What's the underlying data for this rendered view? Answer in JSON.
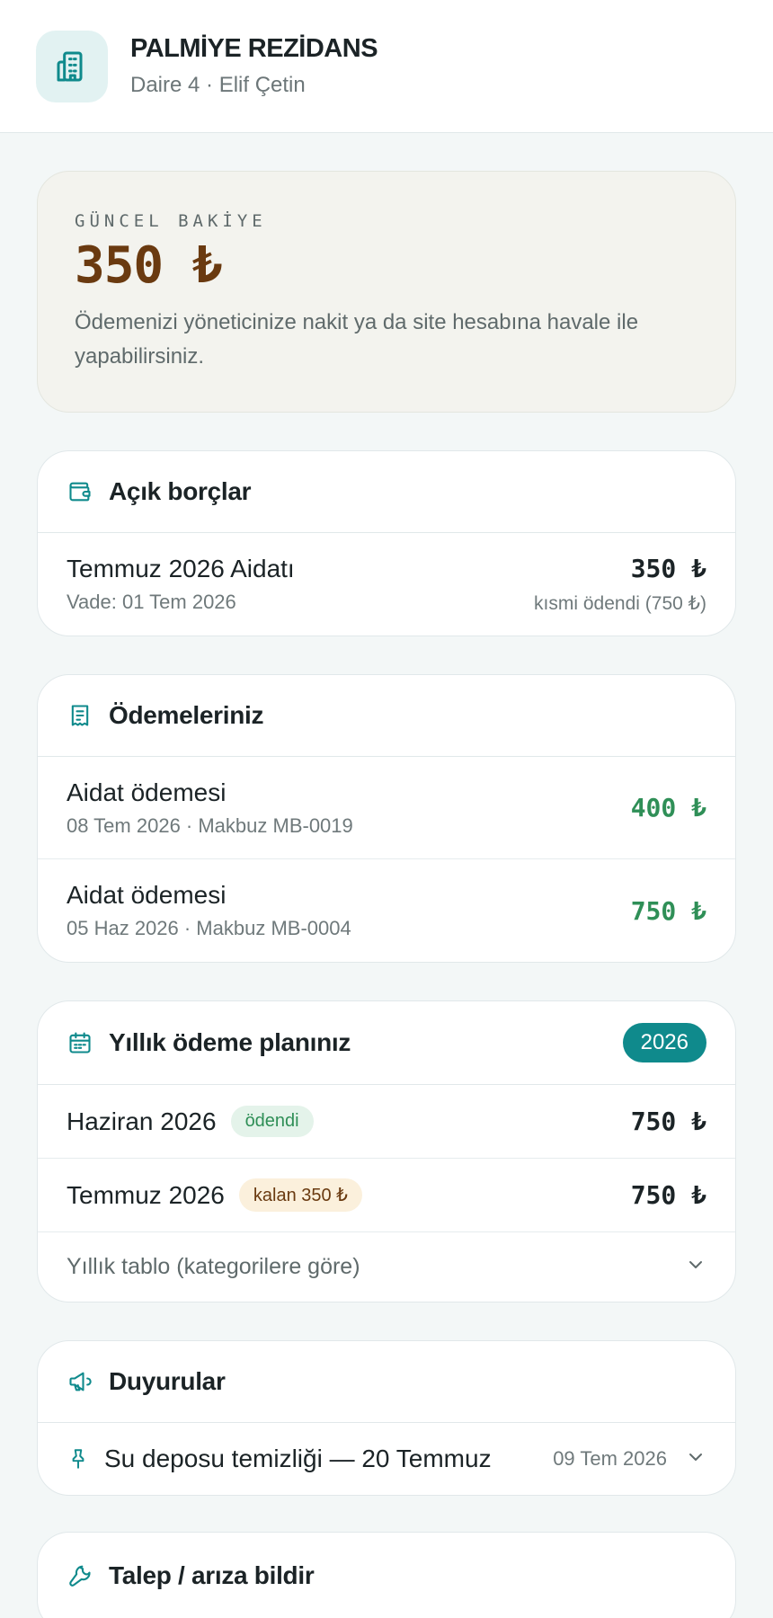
{
  "header": {
    "site_name": "PALMİYE REZİDANS",
    "subtitle": "Daire 4 · Elif Çetin",
    "logo_icon": "building-icon"
  },
  "balance": {
    "label": "GÜNCEL BAKİYE",
    "amount": "350 ₺",
    "note": "Ödemenizi yöneticinize nakit ya da site hesabına havale ile yapabilirsiniz."
  },
  "open_debts": {
    "title": "Açık borçlar",
    "icon": "wallet-icon",
    "items": [
      {
        "name": "Temmuz 2026 Aidatı",
        "due": "Vade: 01 Tem 2026",
        "amount": "350 ₺",
        "status": "kısmi ödendi (750 ₺)"
      }
    ]
  },
  "payments": {
    "title": "Ödemeleriniz",
    "icon": "receipt-icon",
    "items": [
      {
        "name": "Aidat ödemesi",
        "detail": "08 Tem 2026 · Makbuz MB-0019",
        "amount": "400 ₺"
      },
      {
        "name": "Aidat ödemesi",
        "detail": "05 Haz 2026 · Makbuz MB-0004",
        "amount": "750 ₺"
      }
    ]
  },
  "annual_plan": {
    "title": "Yıllık ödeme planınız",
    "icon": "calendar-icon",
    "year": "2026",
    "items": [
      {
        "month": "Haziran 2026",
        "badge": "ödendi",
        "amount": "750 ₺"
      },
      {
        "month": "Temmuz 2026",
        "badge": "kalan 350 ₺",
        "amount": "750 ₺"
      }
    ],
    "table_toggle": "Yıllık tablo (kategorilere göre)"
  },
  "announcements": {
    "title": "Duyurular",
    "icon": "megaphone-icon",
    "items": [
      {
        "text": "Su deposu temizliği — 20 Temmuz",
        "date": "09 Tem 2026"
      }
    ]
  },
  "request": {
    "title": "Talep / arıza bildir",
    "icon": "wrench-icon"
  },
  "colors": {
    "accent": "#0f8a8c",
    "balance": "#6a3a10",
    "paid": "#2f8f57"
  }
}
